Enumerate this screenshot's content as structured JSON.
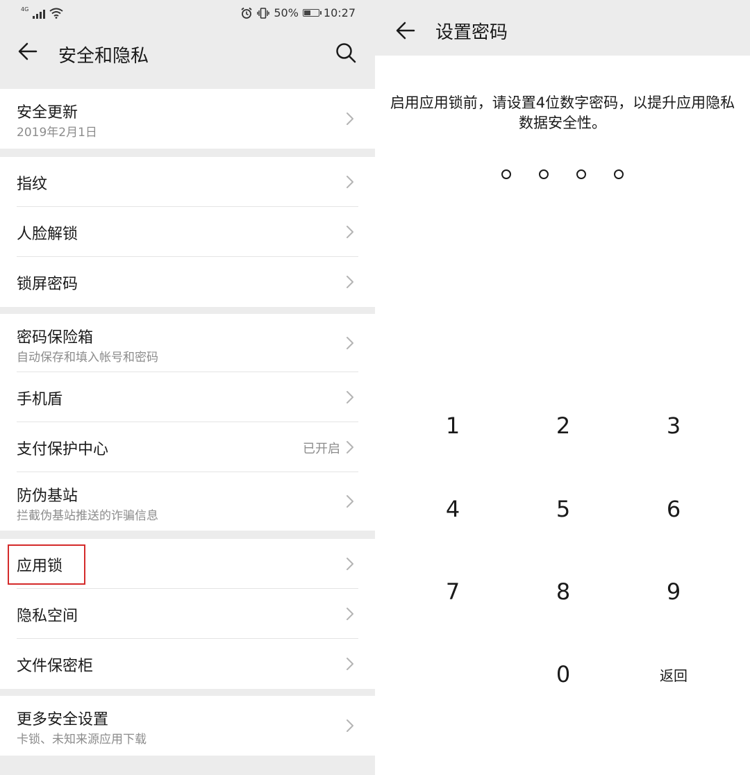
{
  "status_bar": {
    "network": "4G",
    "battery_text": "50%",
    "battery_level": 0.5,
    "time": "10:27"
  },
  "security_page": {
    "title": "安全和隐私",
    "icons": {
      "back": "arrow-left-icon",
      "search": "search-icon",
      "chevron": "chevron-right-icon"
    },
    "groups": [
      {
        "items": [
          {
            "title": "安全更新",
            "subtitle": "2019年2月1日"
          }
        ]
      },
      {
        "items": [
          {
            "title": "指纹"
          },
          {
            "title": "人脸解锁"
          },
          {
            "title": "锁屏密码"
          }
        ]
      },
      {
        "items": [
          {
            "title": "密码保险箱",
            "subtitle": "自动保存和填入帐号和密码"
          },
          {
            "title": "手机盾"
          },
          {
            "title": "支付保护中心",
            "value": "已开启"
          },
          {
            "title": "防伪基站",
            "subtitle": "拦截伪基站推送的诈骗信息"
          }
        ]
      },
      {
        "items": [
          {
            "title": "应用锁",
            "highlighted": true
          },
          {
            "title": "隐私空间"
          },
          {
            "title": "文件保密柜"
          }
        ]
      },
      {
        "items": [
          {
            "title": "更多安全设置",
            "subtitle": "卡锁、未知来源应用下载"
          }
        ]
      }
    ],
    "highlight_color": "#d42a2a"
  },
  "password_page": {
    "title": "设置密码",
    "instruction": "启用应用锁前，请设置4位数字密码，以提升应用隐私数据安全性。",
    "pin_length": 4,
    "pin_entered": 0,
    "keypad": {
      "keys": [
        "1",
        "2",
        "3",
        "4",
        "5",
        "6",
        "7",
        "8",
        "9",
        "0"
      ],
      "back_label": "返回"
    }
  }
}
